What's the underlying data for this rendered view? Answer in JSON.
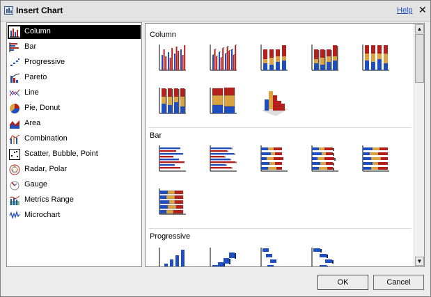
{
  "dialog": {
    "title": "Insert Chart",
    "help_label": "Help",
    "close_glyph": "✕"
  },
  "categories": [
    {
      "label": "Column",
      "icon": "column-chart-icon",
      "selected": true
    },
    {
      "label": "Bar",
      "icon": "bar-chart-icon"
    },
    {
      "label": "Progressive",
      "icon": "progressive-chart-icon"
    },
    {
      "label": "Pareto",
      "icon": "pareto-chart-icon"
    },
    {
      "label": "Line",
      "icon": "line-chart-icon"
    },
    {
      "label": "Pie, Donut",
      "icon": "pie-chart-icon"
    },
    {
      "label": "Area",
      "icon": "area-chart-icon"
    },
    {
      "label": "Combination",
      "icon": "combination-chart-icon"
    },
    {
      "label": "Scatter, Bubble, Point",
      "icon": "scatter-chart-icon"
    },
    {
      "label": "Radar, Polar",
      "icon": "radar-chart-icon"
    },
    {
      "label": "Gauge",
      "icon": "gauge-chart-icon"
    },
    {
      "label": "Metrics Range",
      "icon": "metrics-range-icon"
    },
    {
      "label": "Microchart",
      "icon": "microchart-icon"
    }
  ],
  "sections": [
    {
      "title": "Column",
      "thumbnail_count": 8
    },
    {
      "title": "Bar",
      "thumbnail_count": 6
    },
    {
      "title": "Progressive",
      "thumbnail_count": 4
    }
  ],
  "buttons": {
    "ok": "OK",
    "cancel": "Cancel"
  },
  "colors": {
    "red": "#b3201c",
    "blue": "#1f4fbf",
    "gold": "#d9a441",
    "selection": "#000000"
  }
}
